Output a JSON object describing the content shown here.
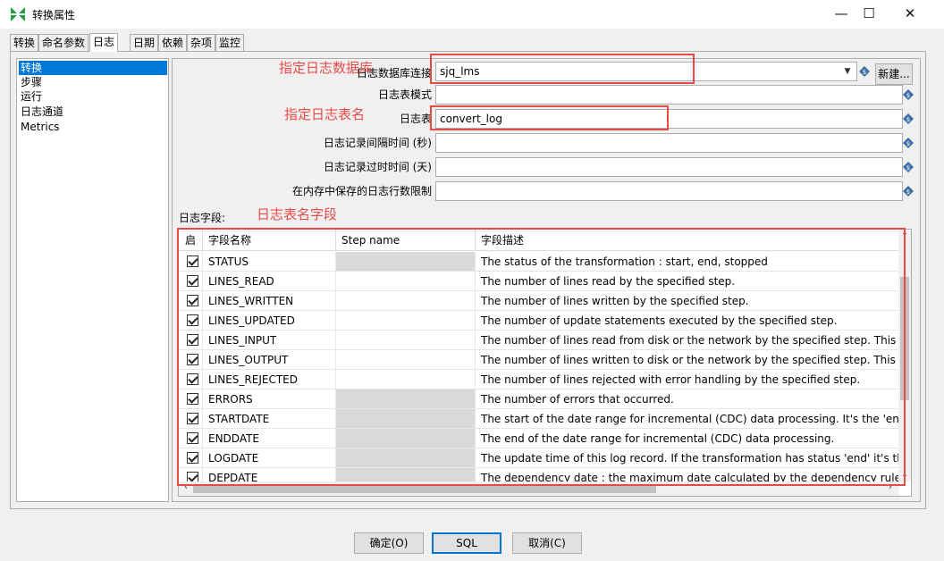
{
  "window": {
    "title": "转换属性",
    "minimize": "—",
    "maximize": "☐",
    "close": "✕"
  },
  "tabs": [
    "转换",
    "命名参数",
    "日志",
    "日期",
    "依赖",
    "杂项",
    "监控"
  ],
  "nav_items": [
    "转换",
    "步骤",
    "运行",
    "日志通道",
    "Metrics"
  ],
  "form": {
    "db_connection_label": "日志数据库连接",
    "db_connection_value": "sjq_lms",
    "new_button": "新建...",
    "schema_label": "日志表模式",
    "schema_value": "",
    "table_label": "日志表",
    "table_value": "convert_log",
    "interval_label": "日志记录间隔时间 (秒)",
    "interval_value": "",
    "timeout_label": "日志记录过时时间 (天)",
    "timeout_value": "",
    "max_lines_label": "在内存中保存的日志行数限制",
    "max_lines_value": ""
  },
  "fields_label": "日志字段:",
  "annotations": {
    "db": "指定日志数据库",
    "table": "指定日志表名",
    "fields": "日志表名字段"
  },
  "table": {
    "headers": [
      "启",
      "字段名称",
      "Step name",
      "字段描述"
    ],
    "rows": [
      {
        "name": "STATUS",
        "step_grey": true,
        "desc": "The status of the transformation : start, end, stopped"
      },
      {
        "name": "LINES_READ",
        "step_grey": false,
        "desc": "The number of lines read by the specified step."
      },
      {
        "name": "LINES_WRITTEN",
        "step_grey": false,
        "desc": "The number of lines written by the specified step."
      },
      {
        "name": "LINES_UPDATED",
        "step_grey": false,
        "desc": "The number of update statements executed by the specified step."
      },
      {
        "name": "LINES_INPUT",
        "step_grey": false,
        "desc": "The number of lines read from disk or the network by the specified step. This is"
      },
      {
        "name": "LINES_OUTPUT",
        "step_grey": false,
        "desc": "The number of lines written to disk or the network by the specified step. This is"
      },
      {
        "name": "LINES_REJECTED",
        "step_grey": false,
        "desc": "The number of lines rejected with error handling by the specified step."
      },
      {
        "name": "ERRORS",
        "step_grey": true,
        "desc": "The number of errors that occurred."
      },
      {
        "name": "STARTDATE",
        "step_grey": true,
        "desc": "The start of the date range for incremental (CDC) data processing. It's the 'end o"
      },
      {
        "name": "ENDDATE",
        "step_grey": true,
        "desc": "The end of the date range for incremental (CDC) data processing."
      },
      {
        "name": "LOGDATE",
        "step_grey": true,
        "desc": "The update time of this log record.  If the transformation has status 'end' it's the"
      },
      {
        "name": "DEPDATE",
        "step_grey": true,
        "desc": "The dependency date : the maximum date calculated by the dependency rules in"
      }
    ]
  },
  "buttons": {
    "ok": "确定(O)",
    "sql": "SQL",
    "cancel": "取消(C)"
  },
  "colors": {
    "accent": "#0078d7",
    "annotation": "#e84b47"
  }
}
